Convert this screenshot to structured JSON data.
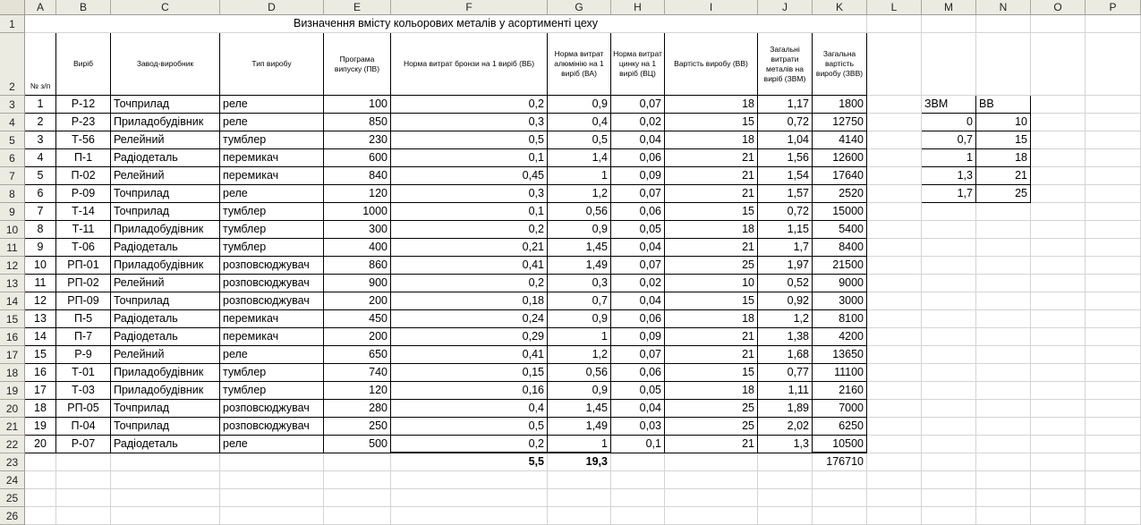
{
  "columns": [
    "A",
    "B",
    "C",
    "D",
    "E",
    "F",
    "G",
    "H",
    "I",
    "J",
    "K",
    "L",
    "M",
    "N",
    "O",
    "P"
  ],
  "rows": [
    "1",
    "2",
    "3",
    "4",
    "5",
    "6",
    "7",
    "8",
    "9",
    "10",
    "11",
    "12",
    "13",
    "14",
    "15",
    "16",
    "17",
    "18",
    "19",
    "20",
    "21",
    "22",
    "23",
    "24",
    "25",
    "26"
  ],
  "title": "Визначення вмісту кольорових металів у асортименті цеху",
  "headers": {
    "num": "№ з/п",
    "product": "Виріб",
    "maker": "Завод-виробник",
    "type": "Тип виробу",
    "program": "Програма випуску (ПВ)",
    "bronze": "Норма витрат бронзи на 1 виріб (ВБ)",
    "aluminium": "Норма витрат алюмінію на 1 виріб (ВА)",
    "zinc": "Норма витрат цинку на 1 виріб (ВЦ)",
    "cost": "Вартість виробу (ВВ)",
    "total_metal": "Загальні витрати металів на виріб (ЗВМ)",
    "total_cost": "Загальна вартість виробу (ЗВВ)"
  },
  "data_rows": [
    {
      "num": "1",
      "product": "Р-12",
      "maker": "Точприлад",
      "type": "реле",
      "program": "100",
      "bronze": "0,2",
      "aluminium": "0,9",
      "zinc": "0,07",
      "cost": "18",
      "total_metal": "1,17",
      "total_cost": "1800"
    },
    {
      "num": "2",
      "product": "Р-23",
      "maker": "Приладобудівник",
      "type": "реле",
      "program": "850",
      "bronze": "0,3",
      "aluminium": "0,4",
      "zinc": "0,02",
      "cost": "15",
      "total_metal": "0,72",
      "total_cost": "12750"
    },
    {
      "num": "3",
      "product": "Т-56",
      "maker": "Релейний",
      "type": "тумблер",
      "program": "230",
      "bronze": "0,5",
      "aluminium": "0,5",
      "zinc": "0,04",
      "cost": "18",
      "total_metal": "1,04",
      "total_cost": "4140"
    },
    {
      "num": "4",
      "product": "П-1",
      "maker": "Радіодеталь",
      "type": "перемикач",
      "program": "600",
      "bronze": "0,1",
      "aluminium": "1,4",
      "zinc": "0,06",
      "cost": "21",
      "total_metal": "1,56",
      "total_cost": "12600"
    },
    {
      "num": "5",
      "product": "П-02",
      "maker": "Релейний",
      "type": "перемикач",
      "program": "840",
      "bronze": "0,45",
      "aluminium": "1",
      "zinc": "0,09",
      "cost": "21",
      "total_metal": "1,54",
      "total_cost": "17640"
    },
    {
      "num": "6",
      "product": "Р-09",
      "maker": "Точприлад",
      "type": "реле",
      "program": "120",
      "bronze": "0,3",
      "aluminium": "1,2",
      "zinc": "0,07",
      "cost": "21",
      "total_metal": "1,57",
      "total_cost": "2520"
    },
    {
      "num": "7",
      "product": "Т-14",
      "maker": "Точприлад",
      "type": "тумблер",
      "program": "1000",
      "bronze": "0,1",
      "aluminium": "0,56",
      "zinc": "0,06",
      "cost": "15",
      "total_metal": "0,72",
      "total_cost": "15000"
    },
    {
      "num": "8",
      "product": "Т-11",
      "maker": "Приладобудівник",
      "type": "тумблер",
      "program": "300",
      "bronze": "0,2",
      "aluminium": "0,9",
      "zinc": "0,05",
      "cost": "18",
      "total_metal": "1,15",
      "total_cost": "5400"
    },
    {
      "num": "9",
      "product": "Т-06",
      "maker": "Радіодеталь",
      "type": "тумблер",
      "program": "400",
      "bronze": "0,21",
      "aluminium": "1,45",
      "zinc": "0,04",
      "cost": "21",
      "total_metal": "1,7",
      "total_cost": "8400"
    },
    {
      "num": "10",
      "product": "РП-01",
      "maker": "Приладобудівник",
      "type": "розповсюджувач",
      "program": "860",
      "bronze": "0,41",
      "aluminium": "1,49",
      "zinc": "0,07",
      "cost": "25",
      "total_metal": "1,97",
      "total_cost": "21500"
    },
    {
      "num": "11",
      "product": "РП-02",
      "maker": "Релейний",
      "type": "розповсюджувач",
      "program": "900",
      "bronze": "0,2",
      "aluminium": "0,3",
      "zinc": "0,02",
      "cost": "10",
      "total_metal": "0,52",
      "total_cost": "9000"
    },
    {
      "num": "12",
      "product": "РП-09",
      "maker": "Точприлад",
      "type": "розповсюджувач",
      "program": "200",
      "bronze": "0,18",
      "aluminium": "0,7",
      "zinc": "0,04",
      "cost": "15",
      "total_metal": "0,92",
      "total_cost": "3000"
    },
    {
      "num": "13",
      "product": "П-5",
      "maker": "Радіодеталь",
      "type": "перемикач",
      "program": "450",
      "bronze": "0,24",
      "aluminium": "0,9",
      "zinc": "0,06",
      "cost": "18",
      "total_metal": "1,2",
      "total_cost": "8100"
    },
    {
      "num": "14",
      "product": "П-7",
      "maker": "Радіодеталь",
      "type": "перемикач",
      "program": "200",
      "bronze": "0,29",
      "aluminium": "1",
      "zinc": "0,09",
      "cost": "21",
      "total_metal": "1,38",
      "total_cost": "4200"
    },
    {
      "num": "15",
      "product": "Р-9",
      "maker": "Релейний",
      "type": "реле",
      "program": "650",
      "bronze": "0,41",
      "aluminium": "1,2",
      "zinc": "0,07",
      "cost": "21",
      "total_metal": "1,68",
      "total_cost": "13650"
    },
    {
      "num": "16",
      "product": "Т-01",
      "maker": "Приладобудівник",
      "type": "тумблер",
      "program": "740",
      "bronze": "0,15",
      "aluminium": "0,56",
      "zinc": "0,06",
      "cost": "15",
      "total_metal": "0,77",
      "total_cost": "11100"
    },
    {
      "num": "17",
      "product": "Т-03",
      "maker": "Приладобудівник",
      "type": "тумблер",
      "program": "120",
      "bronze": "0,16",
      "aluminium": "0,9",
      "zinc": "0,05",
      "cost": "18",
      "total_metal": "1,11",
      "total_cost": "2160"
    },
    {
      "num": "18",
      "product": "РП-05",
      "maker": "Точприлад",
      "type": "розповсюджувач",
      "program": "280",
      "bronze": "0,4",
      "aluminium": "1,45",
      "zinc": "0,04",
      "cost": "25",
      "total_metal": "1,89",
      "total_cost": "7000"
    },
    {
      "num": "19",
      "product": "П-04",
      "maker": "Точприлад",
      "type": "розповсюджувач",
      "program": "250",
      "bronze": "0,5",
      "aluminium": "1,49",
      "zinc": "0,03",
      "cost": "25",
      "total_metal": "2,02",
      "total_cost": "6250"
    },
    {
      "num": "20",
      "product": "Р-07",
      "maker": "Радіодеталь",
      "type": "реле",
      "program": "500",
      "bronze": "0,2",
      "aluminium": "1",
      "zinc": "0,1",
      "cost": "21",
      "total_metal": "1,3",
      "total_cost": "10500"
    }
  ],
  "totals": {
    "bronze": "5,5",
    "aluminium": "19,3",
    "total_cost": "176710"
  },
  "side_table": {
    "header": [
      "ЗВМ",
      "ВВ"
    ],
    "rows": [
      [
        "0",
        "10"
      ],
      [
        "0,7",
        "15"
      ],
      [
        "1",
        "18"
      ],
      [
        "1,3",
        "21"
      ],
      [
        "1,7",
        "25"
      ]
    ]
  }
}
